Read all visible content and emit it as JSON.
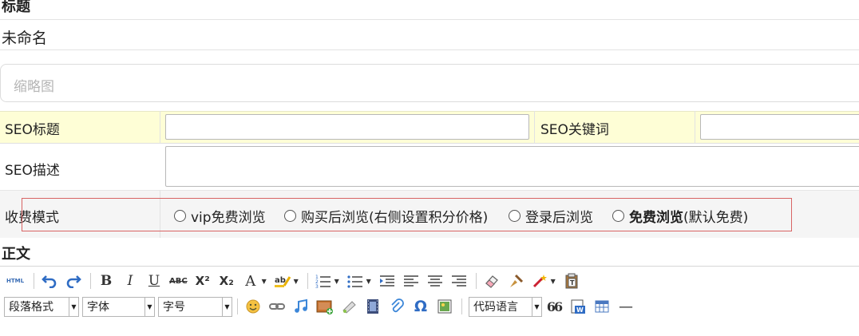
{
  "title_section": {
    "label": "标题",
    "value": "未命名"
  },
  "thumbnail": {
    "placeholder": "缩略图"
  },
  "seo": {
    "title_label": "SEO标题",
    "keywords_label": "SEO关键词",
    "description_label": "SEO描述"
  },
  "charge_mode": {
    "label": "收费模式",
    "options": [
      {
        "label": "vip免费浏览",
        "bold": ""
      },
      {
        "label": "购买后浏览(右侧设置积分价格)",
        "bold": ""
      },
      {
        "label": "登录后浏览",
        "bold": ""
      },
      {
        "bold": "免费浏览",
        "label": " (默认免费)"
      }
    ]
  },
  "body_section": {
    "label": "正文"
  },
  "toolbar": {
    "html_label": "HTML",
    "bold": "B",
    "italic": "I",
    "underline": "U",
    "strike": "ABC",
    "superscript": "X²",
    "subscript": "X₂",
    "font_color": "A",
    "omega": "Ω",
    "quote": "66",
    "hr": "—",
    "paragraph_select": "段落格式",
    "font_select": "字体",
    "size_select": "字号",
    "code_lang_select": "代码语言"
  },
  "colors": {
    "yellow_row": "#fefed6",
    "gray_row": "#f5f5f5",
    "highlight_border": "#d86464",
    "icon_blue": "#2f6cc4"
  }
}
